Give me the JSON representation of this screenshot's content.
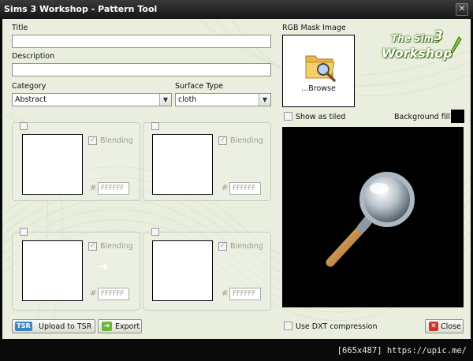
{
  "window": {
    "title": "Sims 3 Workshop - Pattern Tool",
    "close_glyph": "✕"
  },
  "form": {
    "title_label": "Title",
    "title_value": "",
    "description_label": "Description",
    "description_value": "",
    "category_label": "Category",
    "category_value": "Abstract",
    "surface_label": "Surface Type",
    "surface_value": "cloth"
  },
  "channels": [
    {
      "blending_label": "Blending",
      "hash": "#",
      "hex": "FFFFFF"
    },
    {
      "blending_label": "Blending",
      "hash": "#",
      "hex": "FFFFFF"
    },
    {
      "blending_label": "Blending",
      "hash": "#",
      "hex": "FFFFFF"
    },
    {
      "blending_label": "Blending",
      "hash": "#",
      "hex": "FFFFFF"
    }
  ],
  "mask": {
    "label": "RGB Mask Image",
    "browse_label": "...Browse",
    "icon": "folder-magnifier-icon"
  },
  "logo": {
    "line1": "The Sims",
    "numeral": "3",
    "line2": "Workshop"
  },
  "preview": {
    "show_tiled_label": "Show as tiled",
    "background_label": "Background fill",
    "background_color": "#000000",
    "icon": "magnifier-icon"
  },
  "footer": {
    "upload_icon_text": "TSR",
    "upload_label": "Upload to TSR",
    "export_label": "Export",
    "dxt_label": "Use DXT compression",
    "close_label": "Close"
  },
  "status": {
    "text": "[665x487] https://upic.me/"
  }
}
